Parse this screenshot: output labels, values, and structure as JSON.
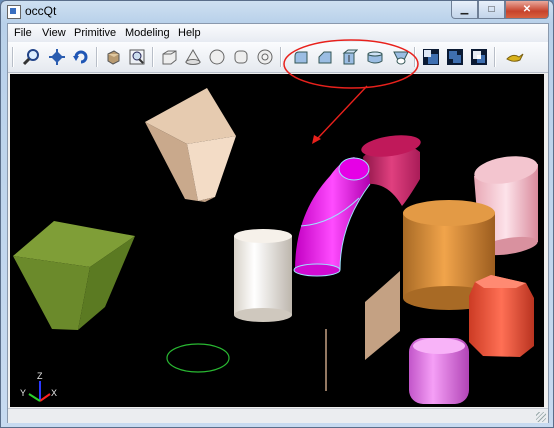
{
  "window": {
    "title": "occQt"
  },
  "caption_buttons": {
    "minimize": "▁",
    "maximize": "□",
    "close": "✕"
  },
  "menubar": {
    "file": "File",
    "view": "View",
    "primitive": "Primitive",
    "modeling": "Modeling",
    "help": "Help"
  },
  "axis_triad": {
    "x": "X",
    "y": "Y",
    "z": "Z"
  },
  "colors": {
    "callout": "#e8211c",
    "background": "#000000",
    "selection_highlight": "#ff00ff"
  }
}
